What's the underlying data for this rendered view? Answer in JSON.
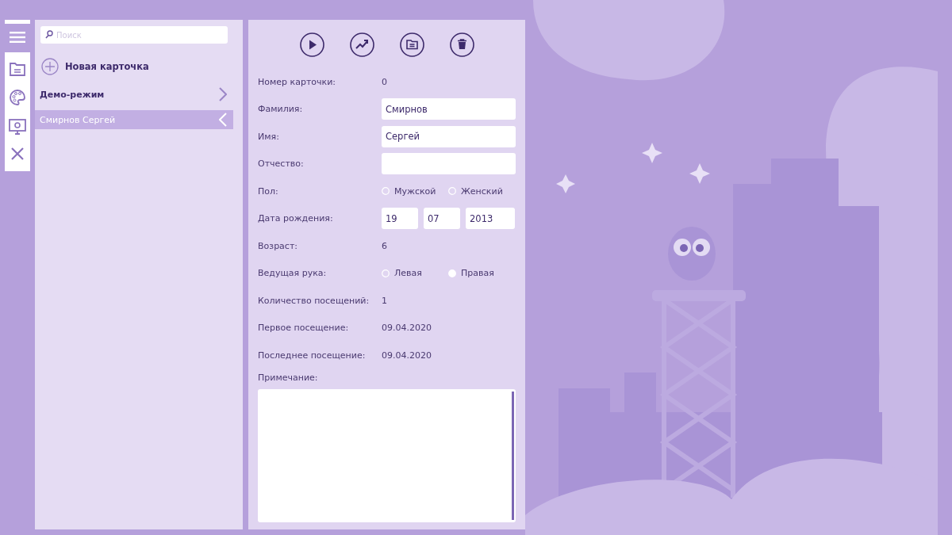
{
  "search": {
    "placeholder": "Поиск"
  },
  "new_card": {
    "label": "Новая карточка"
  },
  "list": [
    {
      "label": "Демо-режим",
      "kind": "group",
      "selected": false
    },
    {
      "label": "Смирнов Сергей",
      "kind": "item",
      "selected": true
    }
  ],
  "form": [
    {
      "kind": "text",
      "label": "Номер карточки:",
      "value": "0"
    },
    {
      "kind": "input",
      "label": "Фамилия:",
      "value": "Смирнов"
    },
    {
      "kind": "input",
      "label": "Имя:",
      "value": "Сергей"
    },
    {
      "kind": "input",
      "label": "Отчество:"
    },
    {
      "kind": "radio",
      "label": "Пол:",
      "options": [
        {
          "label": "Мужской",
          "selected": false
        },
        {
          "label": "Женский",
          "selected": false
        }
      ]
    },
    {
      "kind": "date",
      "label": "Дата рождения:",
      "parts": [
        "19",
        "07",
        "2013"
      ]
    },
    {
      "kind": "text",
      "label": "Возраст:",
      "value": "6"
    },
    {
      "kind": "radio",
      "label": "Ведущая рука:",
      "options": [
        {
          "label": "Левая",
          "selected": false
        },
        {
          "label": "Правая",
          "selected": true
        }
      ]
    },
    {
      "kind": "text",
      "label": "Количество посещений:",
      "value": "1"
    },
    {
      "kind": "text",
      "label": "Первое посещение:",
      "value": "09.04.2020"
    },
    {
      "kind": "text",
      "label": "Последнее посещение:",
      "value": "09.04.2020"
    },
    {
      "kind": "textarea",
      "label": "Примечание:"
    }
  ]
}
